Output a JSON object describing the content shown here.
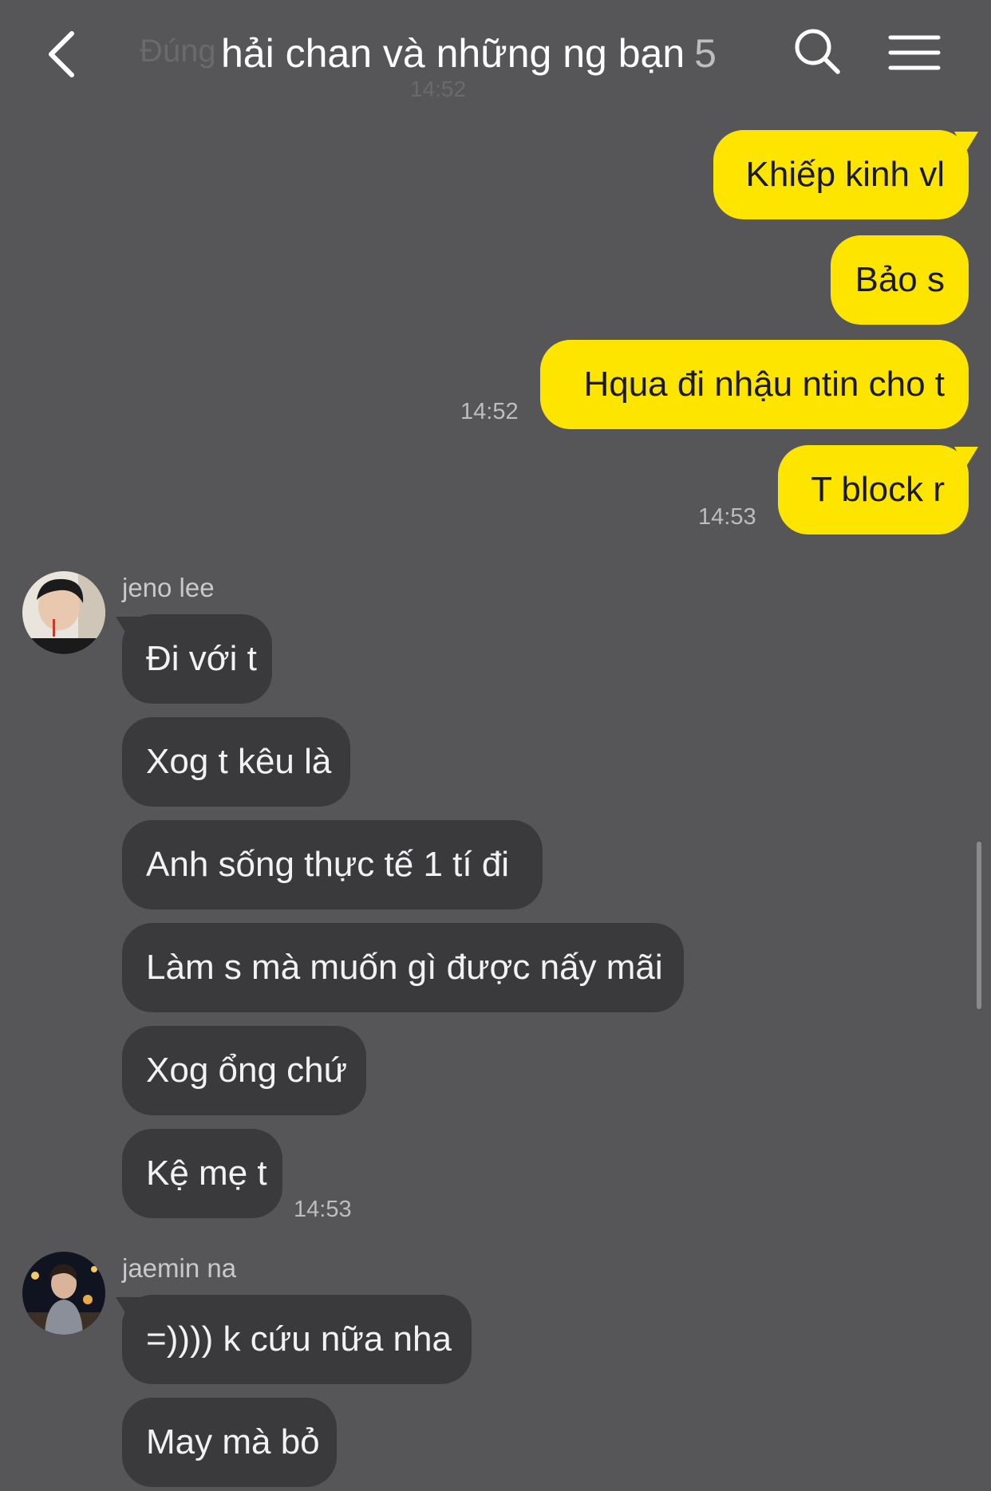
{
  "header": {
    "title": "hải chan và những ng bạn",
    "member_count": "5",
    "ghost_text": "Đúng",
    "ghost_time": "14:52",
    "back_icon": "chevron-left-icon",
    "search_icon": "search-icon",
    "menu_icon": "hamburger-menu-icon"
  },
  "outgoing": [
    {
      "text": "Khiếp kinh vl"
    },
    {
      "text": "Bảo s"
    },
    {
      "text": "Hqua đi nhậu ntin cho t",
      "time": "14:52"
    },
    {
      "text": "T block r",
      "time": "14:53"
    }
  ],
  "groups": [
    {
      "sender": "jeno lee",
      "messages": [
        {
          "text": "Đi với t"
        },
        {
          "text": "Xog t kêu là"
        },
        {
          "text": "Anh sống thực tế 1 tí đi"
        },
        {
          "text": "Làm s mà muốn gì được nấy mãi"
        },
        {
          "text": "Xog ổng chứ"
        },
        {
          "text": "Kệ mẹ t",
          "time": "14:53"
        }
      ]
    },
    {
      "sender": "jaemin na",
      "messages": [
        {
          "text": "=)))) k cứu nữa nha"
        },
        {
          "text": "May mà bỏ"
        }
      ]
    }
  ],
  "colors": {
    "background": "#565558",
    "outgoing_bubble": "#fee500",
    "incoming_bubble": "#3a393c"
  }
}
